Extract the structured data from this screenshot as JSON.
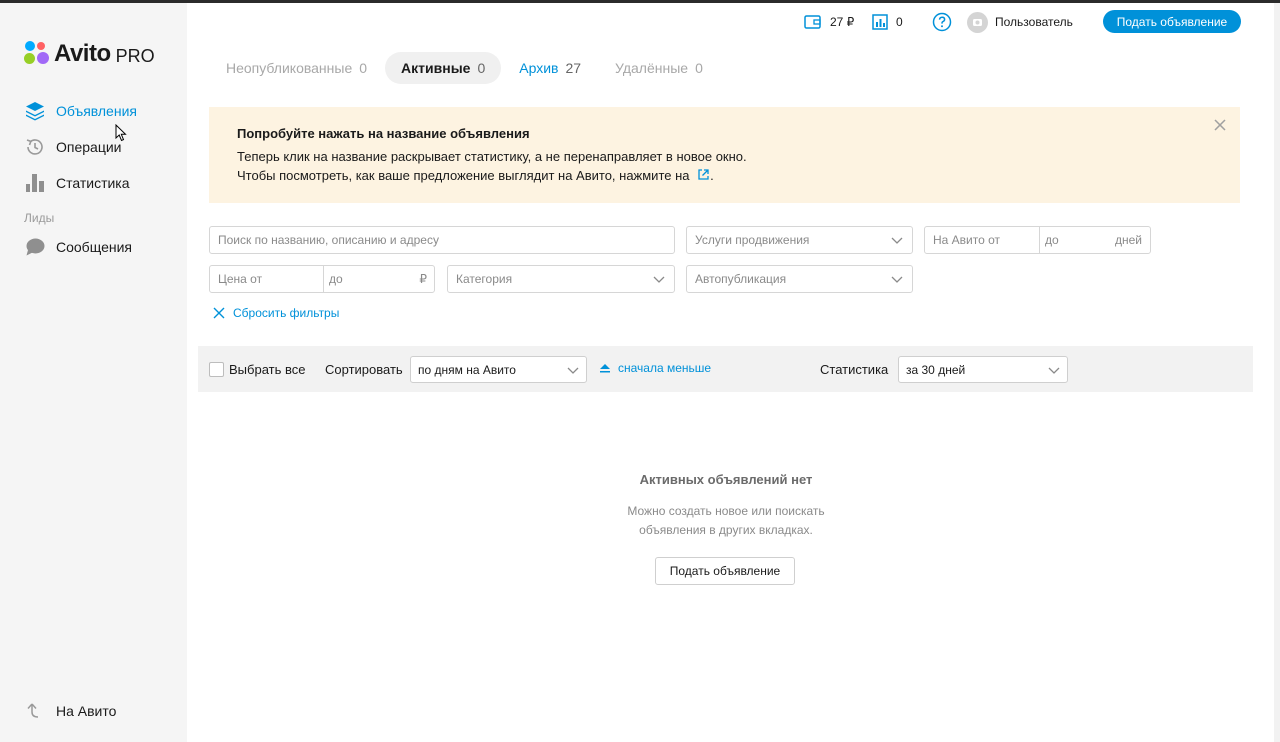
{
  "brand": {
    "name": "Avito",
    "suffix": "PRO",
    "dot_colors": [
      "#97cf26",
      "#0af",
      "#a169f7",
      "#ff6163"
    ]
  },
  "sidebar": {
    "items": [
      {
        "label": "Объявления",
        "icon": "layers-icon",
        "active": true
      },
      {
        "label": "Операции",
        "icon": "history-icon",
        "active": false
      },
      {
        "label": "Статистика",
        "icon": "bar-chart-icon",
        "active": false
      }
    ],
    "section_label": "Лиды",
    "messages_label": "Сообщения",
    "back_label": "На Авито"
  },
  "topbar": {
    "wallet_value": "27 ₽",
    "stats_value": "0",
    "user_label": "Пользователь",
    "submit_label": "Подать объявление"
  },
  "tabs": [
    {
      "label": "Неопубликованные",
      "count": "0",
      "state": "inactive"
    },
    {
      "label": "Активные",
      "count": "0",
      "state": "active"
    },
    {
      "label": "Архив",
      "count": "27",
      "state": "link"
    },
    {
      "label": "Удалённые",
      "count": "0",
      "state": "inactive"
    }
  ],
  "banner": {
    "title": "Попробуйте нажать на название объявления",
    "line1": "Теперь клик на название раскрывает статистику, а не перенаправляет в новое окно.",
    "line2": "Чтобы посмотреть, как ваше предложение выглядит на Авито, нажмите на",
    "line2_end": "."
  },
  "filters": {
    "search_placeholder": "Поиск по названию, описанию и адресу",
    "services": "Услуги продвижения",
    "on_avito_from": "На Авито от",
    "on_avito_to": "до",
    "days_unit": "дней",
    "price_from": "Цена от",
    "price_to": "до",
    "currency": "₽",
    "category": "Категория",
    "autopublish": "Автопубликация",
    "reset_label": "Сбросить фильтры"
  },
  "sortbar": {
    "select_all": "Выбрать все",
    "sort_label": "Сортировать",
    "sort_value": "по дням на Авито",
    "direction": "сначала меньше",
    "stats_label": "Статистика",
    "stats_value": "за 30 дней"
  },
  "empty": {
    "title": "Активных объявлений нет",
    "line1": "Можно создать новое или поискать",
    "line2": "объявления в других вкладках.",
    "button": "Подать объявление"
  },
  "colors": {
    "accent": "#0091d9",
    "banner_bg": "#fdf3e1",
    "sidebar_bg": "#f5f5f5"
  }
}
